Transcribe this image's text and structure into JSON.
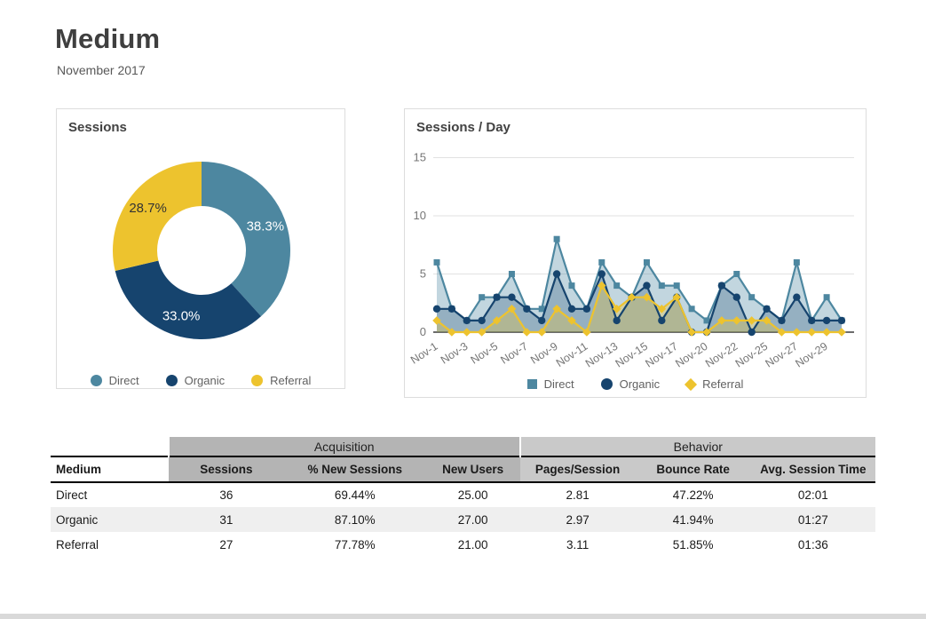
{
  "page": {
    "title": "Medium",
    "subtitle": "November 2017"
  },
  "colors": {
    "direct": "#4d87a0",
    "organic": "#16446e",
    "referral": "#edc32e",
    "grid_line": "#e2e2e2",
    "zero_line": "#3c3c3c",
    "axis_text": "#757575",
    "legend_text": "#616161"
  },
  "chart_data": [
    {
      "id": "sessions-donut",
      "type": "pie",
      "title": "Sessions",
      "labels": [
        "Direct",
        "Organic",
        "Referral"
      ],
      "values": [
        38.3,
        33.0,
        28.7
      ],
      "value_labels": [
        "38.3%",
        "33.0%",
        "28.7%"
      ],
      "label_colors": [
        "#ffffff",
        "#ffffff",
        "#333333"
      ],
      "colors": [
        "#4d87a0",
        "#16446e",
        "#edc32e"
      ],
      "donut_hole_ratio": 0.5,
      "start_angle_deg": 0,
      "direction": "clockwise",
      "legend_position": "bottom"
    },
    {
      "id": "sessions-per-day",
      "type": "area",
      "title": "Sessions / Day",
      "x": [
        "Nov-1",
        "Nov-2",
        "Nov-3",
        "Nov-4",
        "Nov-5",
        "Nov-6",
        "Nov-7",
        "Nov-8",
        "Nov-9",
        "Nov-10",
        "Nov-11",
        "Nov-12",
        "Nov-13",
        "Nov-14",
        "Nov-15",
        "Nov-16",
        "Nov-17",
        "Nov-18",
        "Nov-20",
        "Nov-21",
        "Nov-22",
        "Nov-23",
        "Nov-25",
        "Nov-26",
        "Nov-27",
        "Nov-28",
        "Nov-29",
        "Nov-30"
      ],
      "x_tick_every": 2,
      "x_labels_shown": [
        "Nov-1",
        "Nov-3",
        "Nov-5",
        "Nov-7",
        "Nov-9",
        "Nov-11",
        "Nov-13",
        "Nov-15",
        "Nov-17",
        "Nov-20",
        "Nov-22",
        "Nov-25",
        "Nov-27",
        "Nov-29"
      ],
      "series": [
        {
          "name": "Direct",
          "marker": "square",
          "color": "#4d87a0",
          "fill": "rgba(77,135,160,0.34)",
          "values": [
            6,
            2,
            1,
            3,
            3,
            5,
            2,
            2,
            8,
            4,
            2,
            6,
            4,
            3,
            6,
            4,
            4,
            2,
            1,
            4,
            5,
            3,
            2,
            1,
            6,
            1,
            3,
            1
          ]
        },
        {
          "name": "Organic",
          "marker": "circle",
          "color": "#16446e",
          "fill": "rgba(22,68,110,0.26)",
          "values": [
            2,
            2,
            1,
            1,
            3,
            3,
            2,
            1,
            5,
            2,
            2,
            5,
            1,
            3,
            4,
            1,
            3,
            0,
            0,
            4,
            3,
            0,
            2,
            1,
            3,
            1,
            1,
            1
          ]
        },
        {
          "name": "Referral",
          "marker": "diamond",
          "color": "#edc32e",
          "fill": "rgba(237,195,46,0.30)",
          "values": [
            1,
            0,
            0,
            0,
            1,
            2,
            0,
            0,
            2,
            1,
            0,
            4,
            2,
            3,
            3,
            2,
            3,
            0,
            0,
            1,
            1,
            1,
            1,
            0,
            0,
            0,
            0,
            0
          ]
        }
      ],
      "ylim": [
        0,
        15
      ],
      "y_ticks": [
        0,
        5,
        10,
        15
      ],
      "grid": "horizontal",
      "legend_position": "bottom"
    }
  ],
  "table": {
    "group_headers": [
      {
        "label": "",
        "colspan": 1,
        "bg": "transparent"
      },
      {
        "label": "Acquisition",
        "colspan": 3,
        "bg": "#b4b4b4"
      },
      {
        "label": "Behavior",
        "colspan": 3,
        "bg": "#c9c9c9"
      }
    ],
    "columns": [
      {
        "label": "Medium",
        "width": "14.3%",
        "bg": "#ffffff"
      },
      {
        "label": "Sessions",
        "width": "14.0%",
        "bg": "#b4b4b4"
      },
      {
        "label": "% New Sessions",
        "width": "17.2%",
        "bg": "#b4b4b4"
      },
      {
        "label": "New Users",
        "width": "11.4%",
        "bg": "#b4b4b4"
      },
      {
        "label": "Pages/Session",
        "width": "14.0%",
        "bg": "#c9c9c9"
      },
      {
        "label": "Bounce Rate",
        "width": "14.0%",
        "bg": "#c9c9c9"
      },
      {
        "label": "Avg. Session Time",
        "width": "15.1%",
        "bg": "#c9c9c9"
      }
    ],
    "row_stripe": "#efefef",
    "rows": [
      [
        "Direct",
        "36",
        "69.44%",
        "25.00",
        "2.81",
        "47.22%",
        "02:01"
      ],
      [
        "Organic",
        "31",
        "87.10%",
        "27.00",
        "2.97",
        "41.94%",
        "01:27"
      ],
      [
        "Referral",
        "27",
        "77.78%",
        "21.00",
        "3.11",
        "51.85%",
        "01:36"
      ]
    ]
  }
}
